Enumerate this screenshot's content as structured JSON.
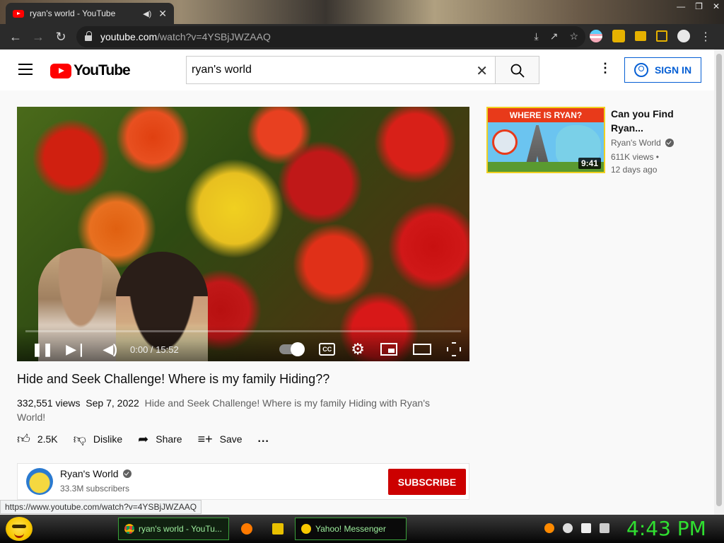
{
  "browser": {
    "tab_title": "ryan's world - YouTube",
    "url_host": "youtube.com",
    "url_path": "/watch?v=4YSBjJWZAAQ",
    "status_url": "https://www.youtube.com/watch?v=4YSBjJWZAAQ"
  },
  "header": {
    "logo_text": "YouTube",
    "search_value": "ryan's world",
    "sign_in_label": "SIGN IN"
  },
  "player": {
    "time": "0:00 / 15:52",
    "progress": 0
  },
  "video": {
    "title": "Hide and Seek Challenge! Where is my family Hiding??",
    "views": "332,551 views",
    "date": "Sep 7, 2022",
    "description": "Hide and Seek Challenge! Where is my family Hiding with Ryan's World!",
    "like_label": "2.5K",
    "dislike_label": "Dislike",
    "share_label": "Share",
    "save_label": "Save",
    "more_label": "..."
  },
  "channel": {
    "name": "Ryan's World",
    "subscribers": "33.3M subscribers",
    "subscribe_label": "SUBSCRIBE"
  },
  "recommendation": {
    "thumb_banner": "WHERE IS RYAN?",
    "duration": "9:41",
    "title": "Can you Find Ryan...",
    "channel": "Ryan's World",
    "views": "611K views •",
    "age": "12 days ago"
  },
  "taskbar": {
    "task1_label": "ryan's world - YouTu...",
    "task2_label": "Yahoo! Messenger",
    "clock": "4:43 PM"
  }
}
